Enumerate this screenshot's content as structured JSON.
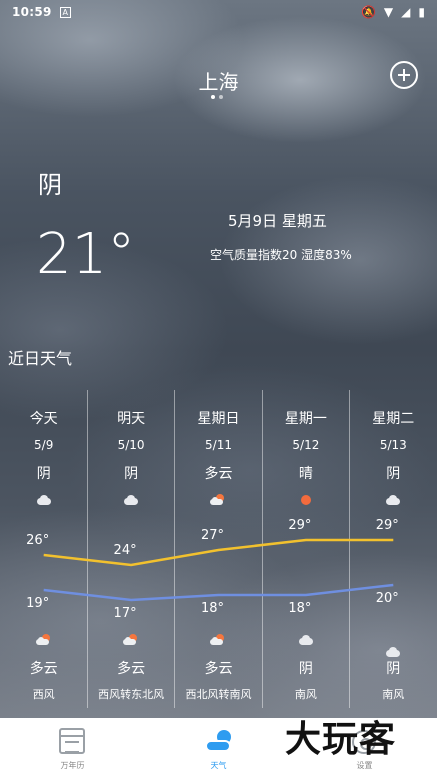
{
  "status_bar": {
    "time": "10:59",
    "notification_icon": "A"
  },
  "header": {
    "city": "上海"
  },
  "current": {
    "condition": "阴",
    "temperature": "21°",
    "date": "5月9日 星期五",
    "air_quality": "空气质量指数20 湿度83%"
  },
  "section_title": "近日天气",
  "forecast": [
    {
      "day": "今天",
      "date": "5/9",
      "day_cond": "阴",
      "day_icon": "cloud-icon",
      "high": "26°",
      "low": "19°",
      "night_icon": "partly-cloudy-icon",
      "night_cond": "多云",
      "wind": "西风"
    },
    {
      "day": "明天",
      "date": "5/10",
      "day_cond": "阴",
      "day_icon": "cloud-icon",
      "high": "24°",
      "low": "17°",
      "night_icon": "partly-cloudy-icon",
      "night_cond": "多云",
      "wind": "西风转东北风"
    },
    {
      "day": "星期日",
      "date": "5/11",
      "day_cond": "多云",
      "day_icon": "partly-cloudy-icon",
      "high": "27°",
      "low": "18°",
      "night_icon": "partly-cloudy-icon",
      "night_cond": "多云",
      "wind": "西北风转南风"
    },
    {
      "day": "星期一",
      "date": "5/12",
      "day_cond": "晴",
      "day_icon": "sun-icon",
      "high": "29°",
      "low": "18°",
      "night_icon": "cloud-icon",
      "night_cond": "阴",
      "wind": "南风"
    },
    {
      "day": "星期二",
      "date": "5/13",
      "day_cond": "阴",
      "day_icon": "cloud-icon",
      "high": "29°",
      "low": "20°",
      "night_icon": "cloud-icon",
      "night_cond": "阴",
      "wind": "南风"
    }
  ],
  "temps": {
    "highs": [
      26,
      24,
      27,
      29,
      29
    ],
    "lows": [
      19,
      17,
      18,
      18,
      20
    ]
  },
  "colors": {
    "high_line": "#f2c12e",
    "low_line": "#6f8fe0",
    "accent": "#2e9cf0"
  },
  "bottom_nav": [
    {
      "label": "万年历",
      "icon": "calendar-icon"
    },
    {
      "label": "天气",
      "icon": "weather-icon"
    },
    {
      "label": "设置",
      "icon": "settings-icon"
    }
  ],
  "watermark": "大玩客"
}
